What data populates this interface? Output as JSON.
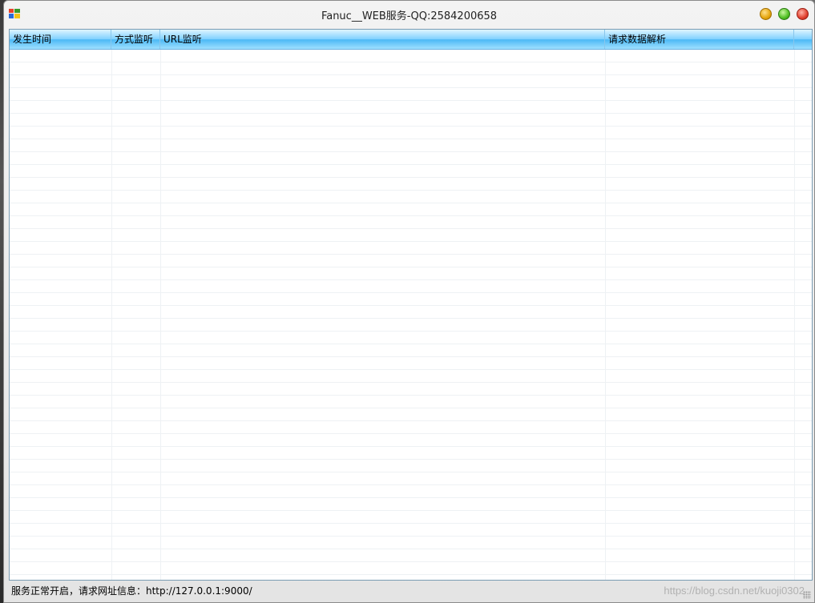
{
  "window": {
    "title": "Fanuc__WEB服务-QQ:2584200658"
  },
  "listview": {
    "columns": [
      {
        "label": "发生时间"
      },
      {
        "label": "方式监听"
      },
      {
        "label": "URL监听"
      },
      {
        "label": "请求数据解析"
      }
    ],
    "rows": []
  },
  "statusbar": {
    "text": "服务正常开启，请求网址信息：http://127.0.0.1:9000/"
  },
  "watermark": {
    "text": "https://blog.csdn.net/kuoji0302"
  },
  "icons": {
    "app": "windows-app-icon",
    "minimize": "minimize-icon",
    "maximize": "maximize-icon",
    "close": "close-icon"
  }
}
